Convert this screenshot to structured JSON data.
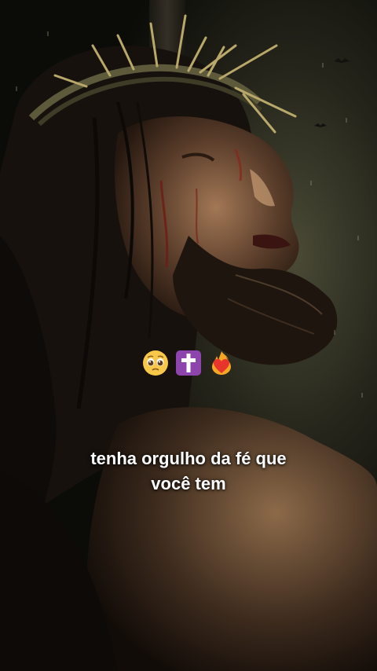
{
  "overlay": {
    "emojis": [
      "pleading-face",
      "latin-cross",
      "heart-on-fire"
    ],
    "caption_line_1": "tenha orgulho da fé que",
    "caption_line_2": "você tem"
  },
  "colors": {
    "background": "#0b0b09",
    "caption_text": "#ffffff",
    "cross_box": "#8e44ad",
    "heart": "#e8352b",
    "flame": "#f5a623",
    "face": "#f7c84a"
  }
}
